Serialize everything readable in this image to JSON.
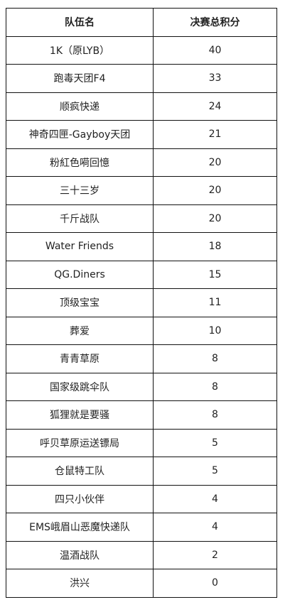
{
  "table": {
    "headers": [
      "队伍名",
      "决赛总积分"
    ],
    "rows": [
      [
        "1K（原LYB）",
        "40"
      ],
      [
        "跑毒天团F4",
        "33"
      ],
      [
        "顺疯快递",
        "24"
      ],
      [
        "神奇四匣-Gayboy天团",
        "21"
      ],
      [
        "粉紅色嗬回憶",
        "20"
      ],
      [
        "三十三岁",
        "20"
      ],
      [
        "千斤战队",
        "20"
      ],
      [
        "Water Friends",
        "18"
      ],
      [
        "QG.Diners",
        "15"
      ],
      [
        "顶级宝宝",
        "11"
      ],
      [
        "葬爱",
        "10"
      ],
      [
        "青青草原",
        "8"
      ],
      [
        "国家级跳伞队",
        "8"
      ],
      [
        "狐狸就是要骚",
        "8"
      ],
      [
        "呼贝草原运送镖局",
        "5"
      ],
      [
        "仓鼠特工队",
        "5"
      ],
      [
        "四只小伙伴",
        "4"
      ],
      [
        "EMS峨眉山恶魔快递队",
        "4"
      ],
      [
        "温酒战队",
        "2"
      ],
      [
        "洪兴",
        "0"
      ]
    ]
  }
}
